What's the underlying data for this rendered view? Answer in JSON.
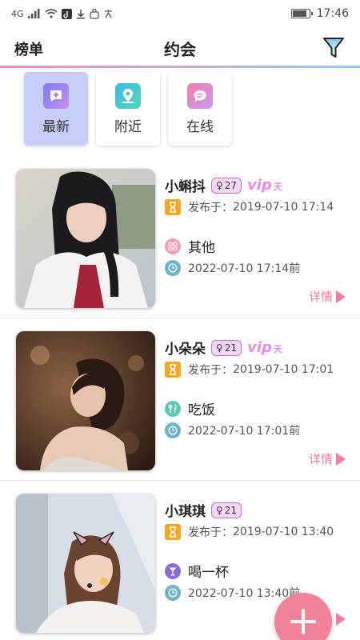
{
  "status": {
    "network": "4G",
    "time": "17:46",
    "battery_level": 0.85
  },
  "header": {
    "left_link": "榜单",
    "title": "约会"
  },
  "tabs": [
    {
      "label": "最新",
      "icon": "add-square-icon",
      "active": true
    },
    {
      "label": "附近",
      "icon": "location-pin-icon",
      "active": false
    },
    {
      "label": "在线",
      "icon": "chat-bubble-icon",
      "active": false
    }
  ],
  "labels": {
    "published_prefix": "发布于：",
    "details": "详情",
    "vip": "vip",
    "vip_sub": "天"
  },
  "posts": [
    {
      "name": "小蝌抖",
      "gender_symbol": "♀",
      "age": "27",
      "vip": true,
      "published": "2019-07-10  17:14",
      "activity": "其他",
      "activity_icon": "grid-icon",
      "datetime": "2022-07-10  17:14前"
    },
    {
      "name": "小朵朵",
      "gender_symbol": "♀",
      "age": "21",
      "vip": true,
      "published": "2019-07-10  17:01",
      "activity": "吃饭",
      "activity_icon": "fork-knife-icon",
      "datetime": "2022-07-10  17:01前"
    },
    {
      "name": "小琪琪",
      "gender_symbol": "♀",
      "age": "21",
      "vip": false,
      "published": "2019-07-10  13:40",
      "activity": "喝一杯",
      "activity_icon": "cocktail-glass-icon",
      "datetime": "2022-07-10  13:40前"
    }
  ],
  "colors": {
    "accent_pink": "#f27a9e",
    "vip_purple": "#e58ae7",
    "active_tab": "#c6cdf7",
    "hourglass_orange": "#f5a623"
  }
}
